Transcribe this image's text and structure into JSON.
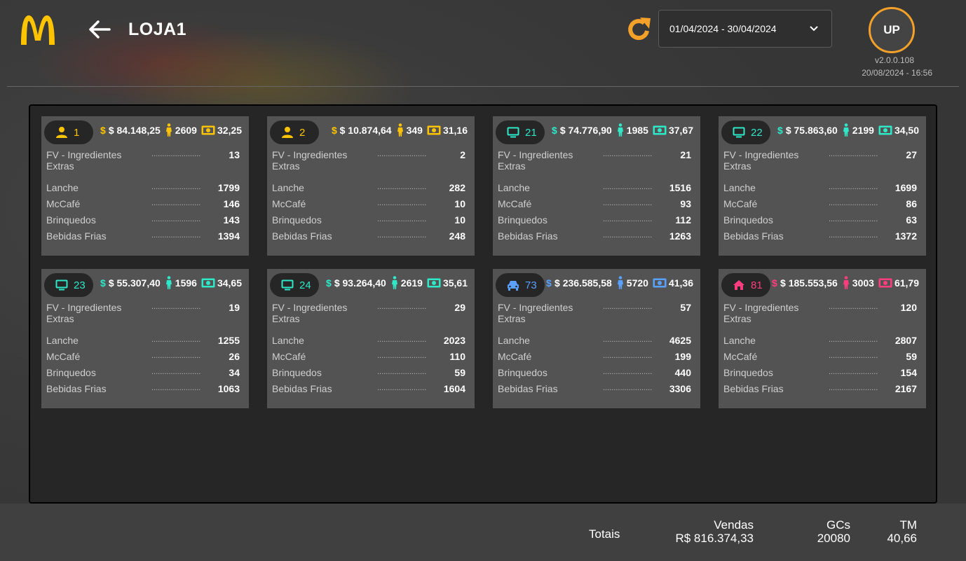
{
  "header": {
    "title": "LOJA1",
    "date_range": "01/04/2024 - 30/04/2024",
    "user_initials": "UP",
    "version": "v2.0.0.108",
    "updated_at": "20/08/2024 - 16:56"
  },
  "colors": {
    "brand_yellow": "#ffc300",
    "accent_orange": "#f4a12a",
    "teal": "#2ee8c8",
    "blue": "#5aa0ff",
    "pink": "#ff3d7f"
  },
  "cards": [
    {
      "code": "1",
      "icon": "person-icon",
      "color": "#ffc300",
      "sales": "$ 84.148,25",
      "guests": "2609",
      "ticket": "32,25",
      "items": [
        {
          "label": "FV - Ingredientes Extras",
          "value": "13"
        },
        {
          "label": "Lanche",
          "value": "1799"
        },
        {
          "label": "McCafé",
          "value": "146"
        },
        {
          "label": "Brinquedos",
          "value": "143"
        },
        {
          "label": "Bebidas Frias",
          "value": "1394"
        }
      ]
    },
    {
      "code": "2",
      "icon": "person-icon",
      "color": "#ffc300",
      "sales": "$ 10.874,64",
      "guests": "349",
      "ticket": "31,16",
      "items": [
        {
          "label": "FV - Ingredientes Extras",
          "value": "2"
        },
        {
          "label": "Lanche",
          "value": "282"
        },
        {
          "label": "McCafé",
          "value": "10"
        },
        {
          "label": "Brinquedos",
          "value": "10"
        },
        {
          "label": "Bebidas Frias",
          "value": "248"
        }
      ]
    },
    {
      "code": "21",
      "icon": "monitor-icon",
      "color": "#2ee8c8",
      "sales": "$ 74.776,90",
      "guests": "1985",
      "ticket": "37,67",
      "items": [
        {
          "label": "FV - Ingredientes Extras",
          "value": "21"
        },
        {
          "label": "Lanche",
          "value": "1516"
        },
        {
          "label": "McCafé",
          "value": "93"
        },
        {
          "label": "Brinquedos",
          "value": "112"
        },
        {
          "label": "Bebidas Frias",
          "value": "1263"
        }
      ]
    },
    {
      "code": "22",
      "icon": "monitor-icon",
      "color": "#2ee8c8",
      "sales": "$ 75.863,60",
      "guests": "2199",
      "ticket": "34,50",
      "items": [
        {
          "label": "FV - Ingredientes Extras",
          "value": "27"
        },
        {
          "label": "Lanche",
          "value": "1699"
        },
        {
          "label": "McCafé",
          "value": "86"
        },
        {
          "label": "Brinquedos",
          "value": "63"
        },
        {
          "label": "Bebidas Frias",
          "value": "1372"
        }
      ]
    },
    {
      "code": "23",
      "icon": "monitor-icon",
      "color": "#2ee8c8",
      "sales": "$ 55.307,40",
      "guests": "1596",
      "ticket": "34,65",
      "items": [
        {
          "label": "FV - Ingredientes Extras",
          "value": "19"
        },
        {
          "label": "Lanche",
          "value": "1255"
        },
        {
          "label": "McCafé",
          "value": "26"
        },
        {
          "label": "Brinquedos",
          "value": "34"
        },
        {
          "label": "Bebidas Frias",
          "value": "1063"
        }
      ]
    },
    {
      "code": "24",
      "icon": "monitor-icon",
      "color": "#2ee8c8",
      "sales": "$ 93.264,40",
      "guests": "2619",
      "ticket": "35,61",
      "items": [
        {
          "label": "FV - Ingredientes Extras",
          "value": "29"
        },
        {
          "label": "Lanche",
          "value": "2023"
        },
        {
          "label": "McCafé",
          "value": "110"
        },
        {
          "label": "Brinquedos",
          "value": "59"
        },
        {
          "label": "Bebidas Frias",
          "value": "1604"
        }
      ]
    },
    {
      "code": "73",
      "icon": "car-icon",
      "color": "#5aa0ff",
      "sales": "$ 236.585,58",
      "guests": "5720",
      "ticket": "41,36",
      "items": [
        {
          "label": "FV - Ingredientes Extras",
          "value": "57"
        },
        {
          "label": "Lanche",
          "value": "4625"
        },
        {
          "label": "McCafé",
          "value": "199"
        },
        {
          "label": "Brinquedos",
          "value": "440"
        },
        {
          "label": "Bebidas Frias",
          "value": "3306"
        }
      ]
    },
    {
      "code": "81",
      "icon": "home-icon",
      "color": "#ff3d7f",
      "sales": "$ 185.553,56",
      "guests": "3003",
      "ticket": "61,79",
      "items": [
        {
          "label": "FV - Ingredientes Extras",
          "value": "120"
        },
        {
          "label": "Lanche",
          "value": "2807"
        },
        {
          "label": "McCafé",
          "value": "59"
        },
        {
          "label": "Brinquedos",
          "value": "154"
        },
        {
          "label": "Bebidas Frias",
          "value": "2167"
        }
      ]
    }
  ],
  "footer": {
    "totals_label": "Totais",
    "sales_label": "Vendas",
    "sales_value": "R$ 816.374,33",
    "gcs_label": "GCs",
    "gcs_value": "20080",
    "tm_label": "TM",
    "tm_value": "40,66"
  }
}
